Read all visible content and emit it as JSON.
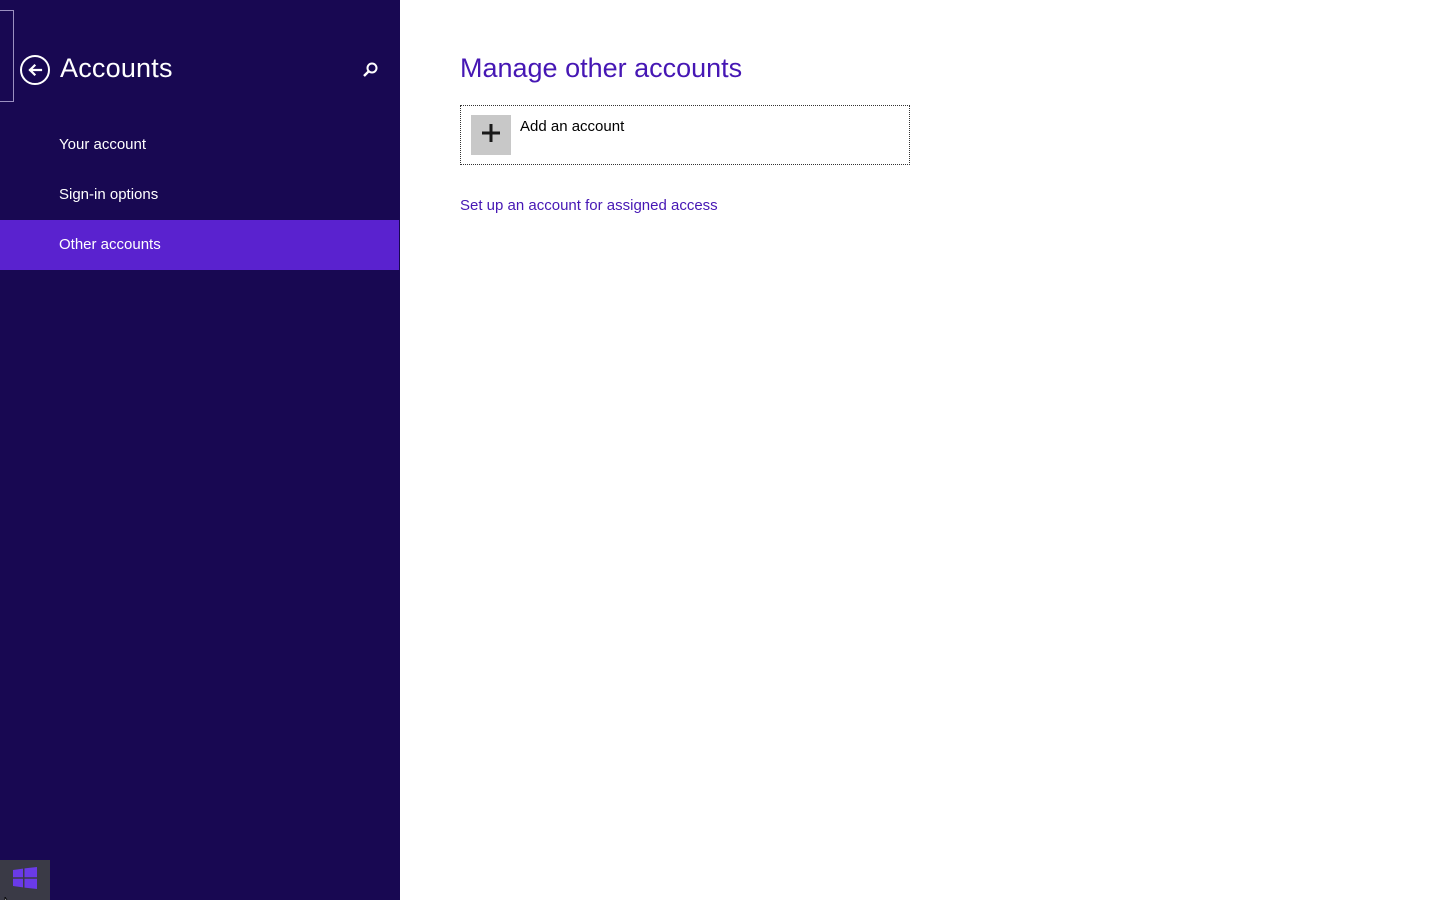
{
  "left_pane": {
    "title": "Accounts",
    "back_icon": "back-arrow-circle-icon",
    "search_icon": "search-icon",
    "nav_items": [
      {
        "label": "Your account",
        "selected": false
      },
      {
        "label": "Sign-in options",
        "selected": false
      },
      {
        "label": "Other accounts",
        "selected": true
      }
    ]
  },
  "content": {
    "title": "Manage other accounts",
    "add_account": {
      "label": "Add an account",
      "icon": "plus-icon"
    },
    "assigned_access_link": "Set up an account for assigned access"
  },
  "taskbar": {
    "start_icon": "windows-logo-icon"
  },
  "colors": {
    "pane_background": "#180852",
    "selected_item": "#5a22cf",
    "accent_text": "#4617b4",
    "add_tile": "#c8c8c8",
    "start_button": "#3a3a46"
  }
}
